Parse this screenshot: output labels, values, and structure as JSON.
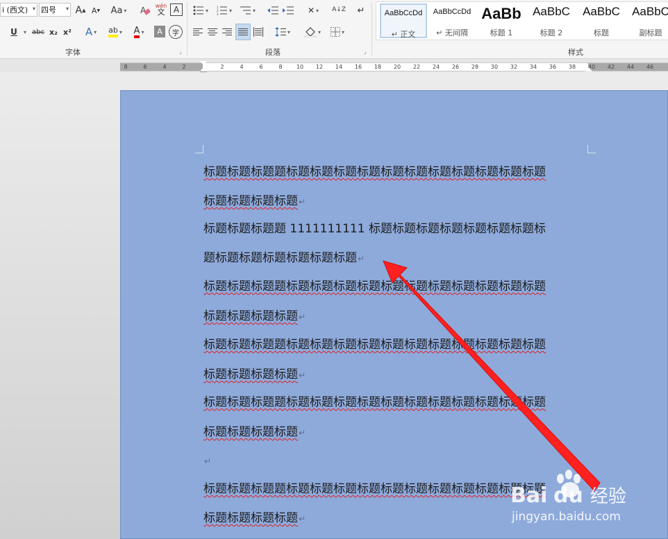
{
  "ribbon": {
    "font_name": "i (西文)",
    "font_size": "四号",
    "grow_font": "A",
    "shrink_font": "A",
    "change_case": "Aa",
    "phonetic_top": "wén",
    "phonetic_bottom": "文",
    "char_border": "A",
    "underline": "U",
    "strikethrough": "abc",
    "subscript": "x₂",
    "superscript": "x²",
    "text_effect": "A",
    "highlight": "ab",
    "font_color": "A",
    "char_shading": "A",
    "enclose_char": "字",
    "sort_icon_label": "A↓Z",
    "groups": {
      "font": "字体",
      "paragraph": "段落",
      "styles": "样式"
    }
  },
  "styles_gallery": [
    {
      "sample": "AaBbCcDd",
      "name": "↵ 正文",
      "selected": true
    },
    {
      "sample": "AaBbCcDd",
      "name": "↵ 无间隔",
      "selected": false
    },
    {
      "sample": "AaBb",
      "name": "标题 1",
      "selected": false
    },
    {
      "sample": "AaBbC",
      "name": "标题 2",
      "selected": false
    },
    {
      "sample": "AaBbC",
      "name": "标题",
      "selected": false
    },
    {
      "sample": "AaBbC",
      "name": "副标题",
      "selected": false
    }
  ],
  "ruler": {
    "left_numbers": [
      "8",
      "6",
      "4",
      "2"
    ],
    "right_numbers": [
      "2",
      "4",
      "6",
      "8",
      "10",
      "12",
      "14",
      "16",
      "18",
      "20",
      "22",
      "24",
      "26",
      "28",
      "30",
      "32",
      "34",
      "36",
      "38",
      "40",
      "42",
      "44",
      "46"
    ]
  },
  "document": {
    "lines": [
      "标题标题标题题标题标题标题标题标题标题标题标题标题标题标题",
      "标题标题标题标题",
      "标题标题标题题 1111111111 标题标题标题标题标题标题标题标",
      "题标题标题标题标题标题标题",
      "标题标题标题题标题标题标题标题标题标题标题标题标题标题标题",
      "标题标题标题标题",
      "标题标题标题题标题标题标题标题标题标题标题标题标题标题标题",
      "标题标题标题标题",
      "标题标题标题题标题标题标题标题标题标题标题标题标题标题标题",
      "标题标题标题标题",
      "",
      "标题标题标题题标题标题标题标题标题标题标题标题标题标题标题",
      "标题标题标题标题"
    ],
    "paragraph_mark": "↵",
    "page_color": "#8eaadb",
    "spell_underline_color": "#e02020"
  },
  "annotation": {
    "arrow_color": "#ff2020"
  },
  "watermark": {
    "brand": "Bai",
    "brand2": "du",
    "product": "经验",
    "url": "jingyan.baidu.com"
  }
}
